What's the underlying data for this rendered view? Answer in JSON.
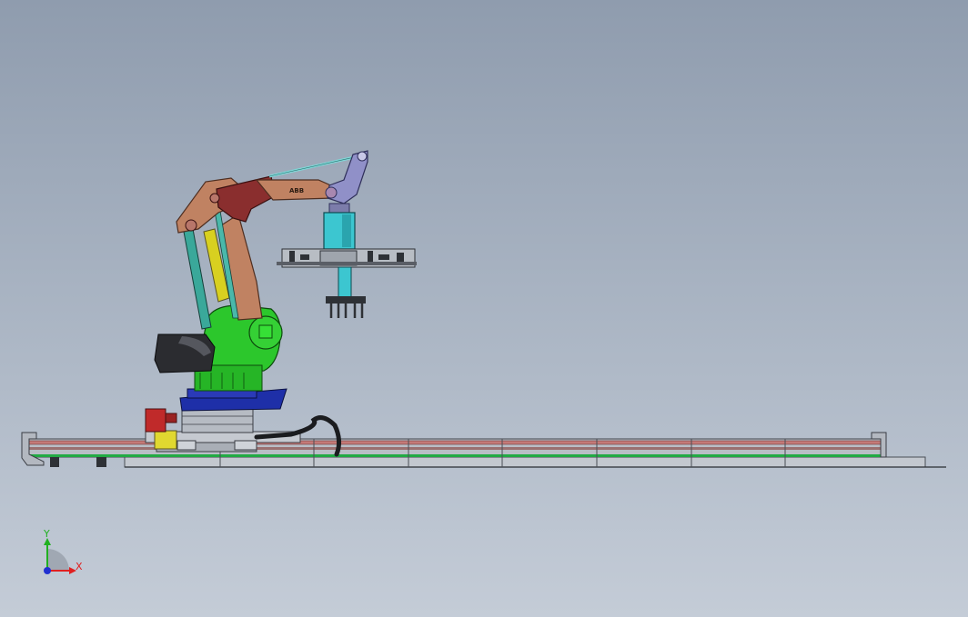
{
  "viewport": {
    "triad": {
      "x_label": "X",
      "y_label": "Y",
      "x_color": "#e02020",
      "y_color": "#20b020",
      "z_color": "#2030d0"
    }
  },
  "model": {
    "arm_brand_mark": "ABB"
  },
  "colors": {
    "base_green": "#2cc72c",
    "arm_copper": "#c08262",
    "arm_dark_red": "#8a2e2e",
    "cylinder_yellow": "#d8d020",
    "link_teal": "#3aa89a",
    "tool_cyan": "#3cc6d0",
    "wrist_lavender": "#9090c8",
    "platform_blue": "#1e2fa8",
    "rail_red": "#c47a78",
    "rail_green": "#22aa44",
    "rail_gray": "#b8bdc4"
  }
}
